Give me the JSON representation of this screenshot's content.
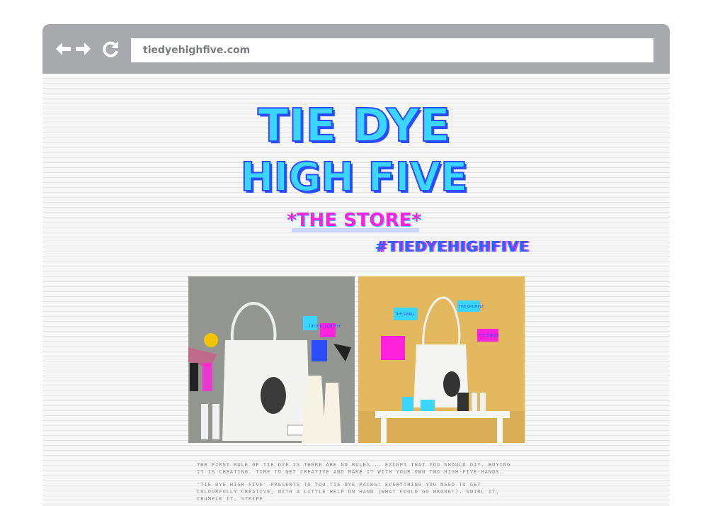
{
  "browser": {
    "url": "tiedyehighfive.com",
    "back_icon": "arrow-left-icon",
    "forward_icon": "arrow-right-icon",
    "reload_icon": "reload-icon"
  },
  "logo": {
    "line1": "TIE DYE",
    "line2": "HIGH FIVE",
    "subtitle": "*THE STORE*"
  },
  "hashtag": "#TIEDYEHIGHFIVE",
  "photos": {
    "left": {
      "labels": [
        "TIE DYE HIGH FIVE",
        "NOTHIN STRESS"
      ]
    },
    "right": {
      "labels": [
        "THE CRUMPLE",
        "THE SWIRL",
        "THE STRIPE"
      ]
    }
  },
  "body": {
    "paragraph1": "The first rule of tie dye is there are no rules... except that you should DIY. Buying it is cheating. Time to get creative and make it with your own two high-five-hands.",
    "paragraph2": "'Tie Dye High Five' presents to you tie dye packs! Everything you need to get colourfully creative, with a little help on hand (what could go wrong!). Swirl it, crumple it, stripe"
  },
  "colors": {
    "chrome": "#a7a9ac",
    "logo_blue": "#2b4cff",
    "logo_cyan": "#3ad6ff",
    "logo_magenta": "#ff22dd",
    "photo_left_bg": "#8c8e8a",
    "photo_right_bg": "#e3b85f"
  }
}
